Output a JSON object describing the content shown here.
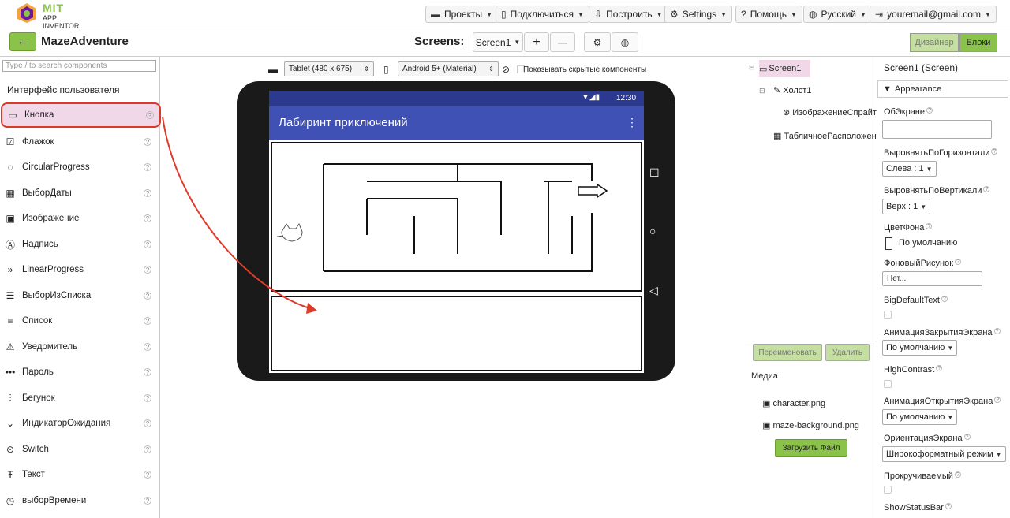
{
  "app": {
    "logo_title": "MIT",
    "logo_sub": "APP INVENTOR"
  },
  "menus": {
    "projects": "Проекты",
    "connect": "Подключиться",
    "build": "Построить",
    "settings": "Settings",
    "help": "Помощь",
    "language": "Русский",
    "account": "youremail@gmail.com"
  },
  "project": {
    "name": "MazeAdventure",
    "screens_label": "Screens:",
    "screen_select": "Screen1",
    "add": "+",
    "remove": "—"
  },
  "mode": {
    "designer": "Дизайнер",
    "blocks": "Блоки"
  },
  "palette": {
    "search_placeholder": "Type / to search components",
    "category": "Интерфейс пользователя",
    "items": [
      {
        "label": "Кнопка",
        "icon": "button-icon"
      },
      {
        "label": "Флажок",
        "icon": "checkbox-icon"
      },
      {
        "label": "CircularProgress",
        "icon": "circular-progress-icon"
      },
      {
        "label": "ВыборДаты",
        "icon": "date-picker-icon"
      },
      {
        "label": "Изображение",
        "icon": "image-icon"
      },
      {
        "label": "Надпись",
        "icon": "label-icon"
      },
      {
        "label": "LinearProgress",
        "icon": "linear-progress-icon"
      },
      {
        "label": "ВыборИзСписка",
        "icon": "list-picker-icon"
      },
      {
        "label": "Список",
        "icon": "list-view-icon"
      },
      {
        "label": "Уведомитель",
        "icon": "notifier-icon"
      },
      {
        "label": "Пароль",
        "icon": "password-icon"
      },
      {
        "label": "Бегунок",
        "icon": "slider-icon"
      },
      {
        "label": "ИндикаторОжидания",
        "icon": "spinner-icon"
      },
      {
        "label": "Switch",
        "icon": "switch-icon"
      },
      {
        "label": "Текст",
        "icon": "textbox-icon"
      },
      {
        "label": "выборВремени",
        "icon": "time-picker-icon"
      }
    ]
  },
  "viewer": {
    "device": "Tablet (480 x 675)",
    "theme": "Android 5+ (Material)",
    "show_hidden": "Показывать скрытые компоненты"
  },
  "phone": {
    "time": "12:30",
    "app_title": "Лабиринт приключений"
  },
  "components": {
    "screen": "Screen1",
    "canvas": "Холст1",
    "sprite": "ИзображениеСпрайт",
    "table": "ТабличноеРасположен",
    "rename": "Переименовать",
    "delete": "Удалить"
  },
  "media": {
    "title": "Медиа",
    "files": [
      "character.png",
      "maze-background.png"
    ],
    "upload": "Загрузить Файл"
  },
  "properties": {
    "header": "Screen1 (Screen)",
    "section": "Appearance",
    "about": "ОбЭкране",
    "align_h": "ВыровнятьПоГоризонтали",
    "align_h_value": "Слева : 1",
    "align_v": "ВыровнятьПоВертикали",
    "align_v_value": "Верх : 1",
    "bg_color": "ЦветФона",
    "bg_color_value": "По умолчанию",
    "bg_image": "ФоновыйРисунок",
    "bg_image_value": "Нет...",
    "big_text": "BigDefaultText",
    "close_anim": "АнимацияЗакрытияЭкрана",
    "close_anim_value": "По умолчанию",
    "high_contrast": "HighContrast",
    "open_anim": "АнимацияОткрытияЭкрана",
    "open_anim_value": "По умолчанию",
    "orientation": "ОриентацияЭкрана",
    "orientation_value": "Широкоформатный режим",
    "scrollable": "Прокручиваемый",
    "status_bar": "ShowStatusBar"
  },
  "colors": {
    "accent_green": "#8bc34a",
    "app_bar": "#3f51b5",
    "selection_red": "#d93a2a"
  }
}
